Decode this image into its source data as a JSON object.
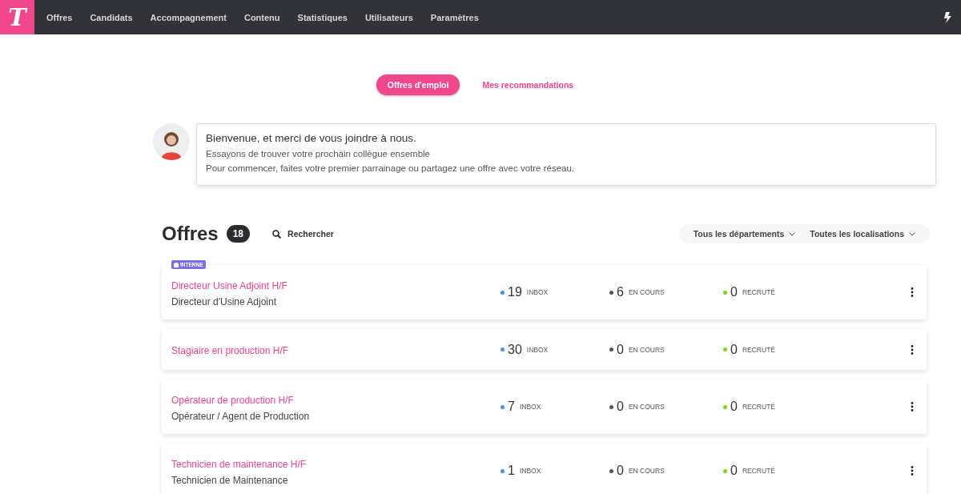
{
  "nav": {
    "logo": "T",
    "items": [
      {
        "label": "Offres",
        "selected": false
      },
      {
        "label": "Candidats",
        "selected": false
      },
      {
        "label": "Accompagnement",
        "selected": false
      },
      {
        "label": "Contenu",
        "selected": false
      },
      {
        "label": "Statistiques",
        "selected": false
      },
      {
        "label": "Utilisateurs",
        "selected": false
      },
      {
        "label": "Paramètres",
        "selected": false
      }
    ]
  },
  "tabs": [
    {
      "label": "Offres d'emploi",
      "selected": true
    },
    {
      "label": "Mes recommandations",
      "selected": false
    }
  ],
  "welcome": {
    "title": "Bienvenue, et merci de vous joindre à nous.",
    "lines": [
      "Essayons de trouver votre prochain collègue ensemble",
      "Pour commencer, faites votre premier parrainage ou partagez une offre avec votre réseau."
    ]
  },
  "offers": {
    "title": "Offres",
    "count": "18",
    "search": "Rechercher",
    "filters": [
      "Tous les départements",
      "Toutes les localisations"
    ],
    "rows": [
      {
        "badge": "INTERNE",
        "title": "Directeur Usine Adjoint H/F",
        "subtitle": "Directeur d'Usine Adjoint",
        "stats": [
          {
            "value": "19",
            "label": "INBOX",
            "color": "#4a90e2"
          },
          {
            "value": "6",
            "label": "EN COURS",
            "color": "#555555"
          },
          {
            "value": "0",
            "label": "RECRUTÉ",
            "color": "#7ed321"
          }
        ]
      },
      {
        "title": "Stagiaire en production H/F",
        "stats": [
          {
            "value": "30",
            "label": "INBOX",
            "color": "#4a90e2"
          },
          {
            "value": "0",
            "label": "EN COURS",
            "color": "#555555"
          },
          {
            "value": "0",
            "label": "RECRUTÉ",
            "color": "#7ed321"
          }
        ]
      },
      {
        "title": "Opérateur de production H/F",
        "subtitle": "Opérateur / Agent de Production",
        "stats": [
          {
            "value": "7",
            "label": "INBOX",
            "color": "#4a90e2"
          },
          {
            "value": "0",
            "label": "EN COURS",
            "color": "#555555"
          },
          {
            "value": "0",
            "label": "RECRUTÉ",
            "color": "#7ed321"
          }
        ]
      },
      {
        "title": "Technicien de maintenance H/F",
        "subtitle": "Technicien de Maintenance",
        "stats": [
          {
            "value": "1",
            "label": "INBOX",
            "color": "#4a90e2"
          },
          {
            "value": "0",
            "label": "EN COURS",
            "color": "#555555"
          },
          {
            "value": "0",
            "label": "RECRUTÉ",
            "color": "#7ed321"
          }
        ]
      }
    ]
  }
}
